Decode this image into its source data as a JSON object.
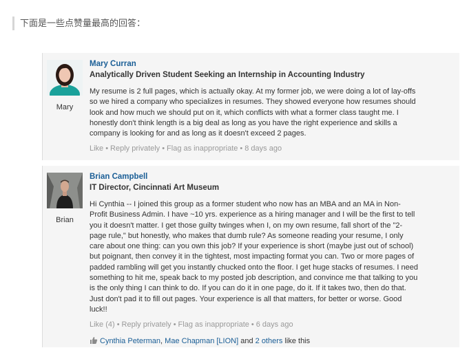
{
  "intro": "下面是一些点赞量最高的回答：",
  "comments": [
    {
      "author": "Mary Curran",
      "avatar_label": "Mary",
      "headline": "Analytically Driven Student Seeking an Internship in Accounting Industry",
      "body": "My resume is 2 full pages, which is actually okay. At my former job, we were doing a lot of lay-offs\nso we hired a company who specializes in resumes. They showed everyone how resumes should\nlook and how much we should put on it, which conflicts with what a former class taught me. I\nhonestly don't think length is a big deal as long as you have the right experience and skills a\ncompany is looking for and as long as it doesn't exceed 2 pages.",
      "like": "Like",
      "reply": "Reply privately",
      "flag": "Flag as inappropriate",
      "time": "8 days ago"
    },
    {
      "author": "Brian Campbell",
      "avatar_label": "Brian",
      "headline": "IT Director, Cincinnati Art Museum",
      "body": "Hi Cynthia -- I joined this group as a former student who now has an MBA and an MA in Non-\nProfit Business Admin. I have ~10 yrs. experience as a hiring manager and I will be the first to tell\nyou it doesn't matter. I get those guilty twinges when I, on my own resume, fall short of the \"2-\npage rule,\" but honestly, who makes that dumb rule? As someone reading your resume, I only\ncare about one thing: can you own this job? If your experience is short (maybe just out of school)\nbut poignant, then convey it in the tightest, most impacting format you can. Two or more pages of\npadded rambling will get you instantly chucked onto the floor. I get huge stacks of resumes. I need\nsomething to hit me, speak back to my posted job description, and convince me that talking to you\nis the only thing I can think to do. If you can do it in one page, do it. If it takes two, then do that.\nJust don't pad it to fill out pages. Your experience is all that matters, for better or worse. Good\nluck!!",
      "like": "Like (4)",
      "reply": "Reply privately",
      "flag": "Flag as inappropriate",
      "time": "6 days ago",
      "liked_by": {
        "person1": "Cynthia Peterman",
        "comma": ", ",
        "person2": "Mae Chapman [LION]",
        "and": " and ",
        "others": "2 others",
        "suffix": " like this"
      }
    }
  ],
  "colors": {
    "link": "#1a5e96",
    "card_bg": "#f5f5f5",
    "muted": "#999999"
  }
}
